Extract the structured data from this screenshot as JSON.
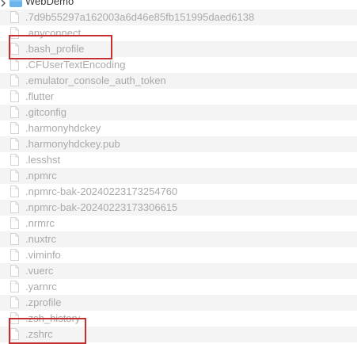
{
  "folder": {
    "name": "WebDemo",
    "icon": "folder-icon"
  },
  "files": [
    ".7d9b55297a162003a6d46e85fb151995daed6138",
    ".anyconnect",
    ".bash_profile",
    ".CFUserTextEncoding",
    ".emulator_console_auth_token",
    ".flutter",
    ".gitconfig",
    ".harmonyhdckey",
    ".harmonyhdckey.pub",
    ".lesshst",
    ".npmrc",
    ".npmrc-bak-20240223173254760",
    ".npmrc-bak-20240223173306615",
    ".nrmrc",
    ".nuxtrc",
    ".viminfo",
    ".vuerc",
    ".yarnrc",
    ".zprofile",
    ".zsh_history",
    ".zshrc"
  ],
  "colors": {
    "highlight": "#c62f2f",
    "row_alt": "#f4f4f4",
    "dim_text": "#a9a9a9",
    "folder_blue": "#6cb4ec"
  }
}
